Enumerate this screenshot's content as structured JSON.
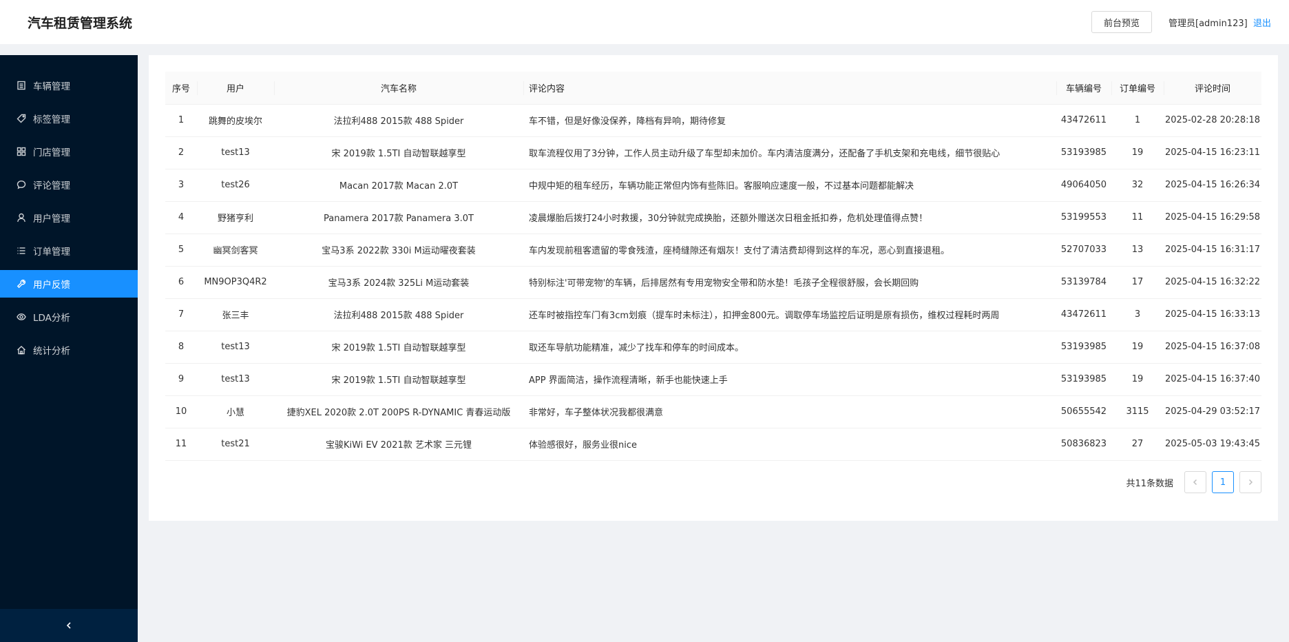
{
  "header": {
    "title": "汽车租赁管理系统",
    "preview_label": "前台预览",
    "admin_label": "管理员[admin123]",
    "logout_label": "退出"
  },
  "sidebar": {
    "items": [
      {
        "label": "车辆管理",
        "icon": "list-icon"
      },
      {
        "label": "标签管理",
        "icon": "tag-icon"
      },
      {
        "label": "门店管理",
        "icon": "store-icon"
      },
      {
        "label": "评论管理",
        "icon": "comment-icon"
      },
      {
        "label": "用户管理",
        "icon": "user-icon"
      },
      {
        "label": "订单管理",
        "icon": "order-icon"
      },
      {
        "label": "用户反馈",
        "icon": "tool-icon"
      },
      {
        "label": "LDA分析",
        "icon": "eye-icon"
      },
      {
        "label": "统计分析",
        "icon": "home-icon"
      }
    ],
    "active_index": 6,
    "collapse_icon": "chevron-left-icon"
  },
  "table": {
    "columns": [
      "序号",
      "用户",
      "汽车名称",
      "评论内容",
      "车辆编号",
      "订单编号",
      "评论时间"
    ],
    "rows": [
      [
        "1",
        "跳舞的皮埃尔",
        "法拉利488 2015款 488 Spider",
        "车不错，但是好像没保养，降档有异响，期待修复",
        "43472611",
        "1",
        "2025-02-28 20:28:18"
      ],
      [
        "2",
        "test13",
        "宋 2019款 1.5TI 自动智联越享型",
        "取车流程仅用了3分钟，工作人员主动升级了车型却未加价。车内清洁度满分，还配备了手机支架和充电线，细节很贴心",
        "53193985",
        "19",
        "2025-04-15 16:23:11"
      ],
      [
        "3",
        "test26",
        "Macan 2017款 Macan 2.0T",
        "中规中矩的租车经历，车辆功能正常但内饰有些陈旧。客服响应速度一般，不过基本问题都能解决",
        "49064050",
        "32",
        "2025-04-15 16:26:34"
      ],
      [
        "4",
        "野猪亨利",
        "Panamera 2017款 Panamera 3.0T",
        "凌晨爆胎后拨打24小时救援，30分钟就完成换胎，还额外赠送次日租金抵扣券，危机处理值得点赞！",
        "53199553",
        "11",
        "2025-04-15 16:29:58"
      ],
      [
        "5",
        "幽冥剑客冥",
        "宝马3系 2022款 330i M运动曜夜套装",
        "车内发现前租客遗留的零食残渣，座椅缝隙还有烟灰！支付了清洁费却得到这样的车况，恶心到直接退租。",
        "52707033",
        "13",
        "2025-04-15 16:31:17"
      ],
      [
        "6",
        "MN9OP3Q4R2",
        "宝马3系 2024款 325Li M运动套装",
        "特别标注'可带宠物'的车辆，后排居然有专用宠物安全带和防水垫！毛孩子全程很舒服，会长期回购",
        "53139784",
        "17",
        "2025-04-15 16:32:22"
      ],
      [
        "7",
        "张三丰",
        "法拉利488 2015款 488 Spider",
        "还车时被指控车门有3cm划痕（提车时未标注），扣押金800元。调取停车场监控后证明是原有损伤，维权过程耗时两周",
        "43472611",
        "3",
        "2025-04-15 16:33:13"
      ],
      [
        "8",
        "test13",
        "宋 2019款 1.5TI 自动智联越享型",
        "取还车导航功能精准，减少了找车和停车的时间成本。",
        "53193985",
        "19",
        "2025-04-15 16:37:08"
      ],
      [
        "9",
        "test13",
        "宋 2019款 1.5TI 自动智联越享型",
        "APP 界面简洁，操作流程清晰，新手也能快速上手",
        "53193985",
        "19",
        "2025-04-15 16:37:40"
      ],
      [
        "10",
        "小慧",
        "捷豹XEL 2020款 2.0T 200PS R-DYNAMIC 青春运动版",
        "非常好，车子整体状况我都很满意",
        "50655542",
        "3115",
        "2025-04-29 03:52:17"
      ],
      [
        "11",
        "test21",
        "宝骏KiWi EV 2021款 艺术家 三元锂",
        "体验感很好，服务业很nice",
        "50836823",
        "27",
        "2025-05-03 19:43:45"
      ]
    ]
  },
  "pagination": {
    "total_text": "共11条数据",
    "current_page": "1",
    "prev_icon": "chevron-left-icon",
    "next_icon": "chevron-right-icon"
  },
  "colors": {
    "accent": "#1890ff",
    "sidebar_bg": "#001529"
  }
}
